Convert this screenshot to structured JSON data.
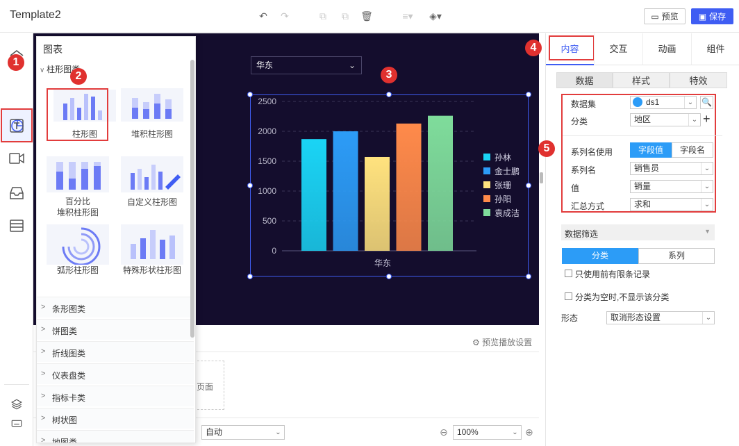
{
  "app": {
    "title": "Template2"
  },
  "toolbar": {
    "preview_label": "预览",
    "save_label": "保存"
  },
  "chart_panel": {
    "title": "图表",
    "open_category": "柱形图类",
    "tiles": [
      "柱形图",
      "堆积柱形图",
      "百分比\n堆积柱形图",
      "自定义柱形图",
      "弧形柱形图",
      "特殊形状柱形图"
    ],
    "tile_lines": {
      "t2a": "百分比",
      "t2b": "堆积柱形图"
    },
    "categories": [
      "条形图类",
      "饼图类",
      "折线图类",
      "仪表盘类",
      "指标卡类",
      "树状图",
      "地图类"
    ]
  },
  "canvas": {
    "region_select": "华东",
    "page_label": "页面",
    "preview_setting": "预览播放设置",
    "mode_select": "自动",
    "zoom": "100%"
  },
  "chart_data": {
    "type": "bar",
    "categories": [
      "孙林",
      "金士鹏",
      "张珊",
      "孙阳",
      "袁成洁"
    ],
    "values": [
      1870,
      2000,
      1570,
      2130,
      2260
    ],
    "xlabel": "华东",
    "ylabel": "",
    "ylim": [
      0,
      2500
    ],
    "yticks": [
      "0",
      "500",
      "1000",
      "1500",
      "2000",
      "2500"
    ],
    "colors": [
      "#1ad4f5",
      "#2c9cf7",
      "#ffe27e",
      "#ff8a4a",
      "#7fdc9b"
    ],
    "legend_position": "right",
    "grid": true
  },
  "right_panel": {
    "tabs": [
      "内容",
      "交互",
      "动画",
      "组件"
    ],
    "subtabs": [
      "数据",
      "样式",
      "特效"
    ],
    "dataset_label": "数据集",
    "dataset_value": "ds1",
    "category_label": "分类",
    "category_value": "地区",
    "series_use_label": "系列名使用",
    "series_use_opt1": "字段值",
    "series_use_opt2": "字段名",
    "series_name_label": "系列名",
    "series_name_value": "销售员",
    "value_label": "值",
    "value_value": "销量",
    "agg_label": "汇总方式",
    "agg_value": "求和",
    "filter_label": "数据筛选",
    "filter_tab1": "分类",
    "filter_tab2": "系列",
    "limit_label": "只使用前有限条记录",
    "empty_label": "分类为空时,不显示该分类",
    "shape_label": "形态",
    "shape_value": "取消形态设置"
  },
  "badges": [
    "1",
    "2",
    "3",
    "4",
    "5"
  ]
}
